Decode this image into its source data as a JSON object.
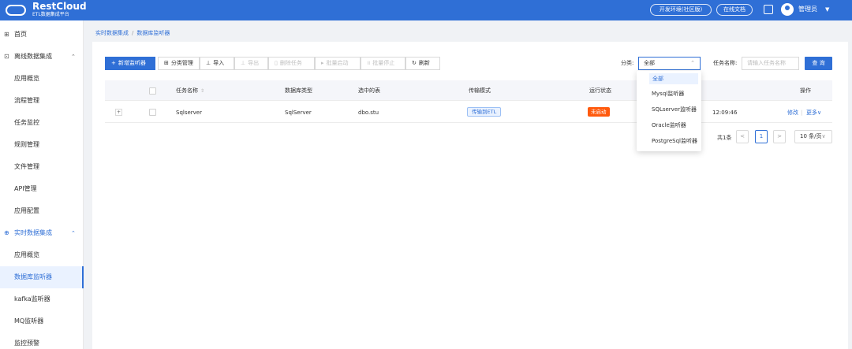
{
  "header": {
    "brand": "RestCloud",
    "brand_sub": "ETL数据集成平台",
    "env_button": "开发环境(社区版)",
    "docs_button": "在线文档",
    "user": "管理员",
    "user_caret": "▼"
  },
  "sidebar": {
    "items": [
      {
        "label": "首页",
        "icon": "⊞"
      },
      {
        "label": "离线数据集成",
        "icon": "⊡",
        "arrow": "⌃"
      },
      {
        "label": "应用概览"
      },
      {
        "label": "流程管理"
      },
      {
        "label": "任务监控"
      },
      {
        "label": "规则管理"
      },
      {
        "label": "文件管理"
      },
      {
        "label": "API管理"
      },
      {
        "label": "应用配置"
      },
      {
        "label": "实时数据集成",
        "icon": "⊕",
        "arrow": "⌃"
      },
      {
        "label": "应用概览"
      },
      {
        "label": "数据库监听器"
      },
      {
        "label": "kafka监听器"
      },
      {
        "label": "MQ监听器"
      },
      {
        "label": "监控预警"
      }
    ]
  },
  "breadcrumb": {
    "parent": "实时数据集成",
    "separator": "/",
    "current": "数据库监听器"
  },
  "toolbar": {
    "add": "新增监听器",
    "category": "分类管理",
    "import": "导入",
    "export": "导出",
    "delete": "删除任务",
    "batch_start": "批量启动",
    "batch_stop": "批量停止",
    "refresh": "刷新"
  },
  "filters": {
    "category_label": "分类:",
    "category_value": "全部",
    "task_label": "任务名称:",
    "task_placeholder": "请输入任务名称",
    "query": "查 询"
  },
  "table": {
    "headers": {
      "name": "任务名称",
      "db_type": "数据库类型",
      "tables": "选中的表",
      "mode": "传输模式",
      "status": "运行状态",
      "ops": "操作"
    },
    "rows": [
      {
        "expand": "+",
        "name": "Sqlserver",
        "db_type": "SqlServer",
        "tables": "dbo.stu",
        "mode": "传输到ETL",
        "status": "未启动",
        "time_fragment": "12:09:46",
        "edit": "修改",
        "more": "更多∨"
      }
    ]
  },
  "pagination": {
    "total": "共1条",
    "prev": "<",
    "page": "1",
    "next": ">",
    "size": "10 条/页"
  },
  "dropdown": {
    "options": [
      "全部",
      "Mysql监听器",
      "SQLserver监听器",
      "Oracle监听器",
      "PostgreSql监听器"
    ],
    "selected_index": 0
  },
  "colors": {
    "primary": "#2f6fd6",
    "status_not_started": "#ff5a0d"
  }
}
